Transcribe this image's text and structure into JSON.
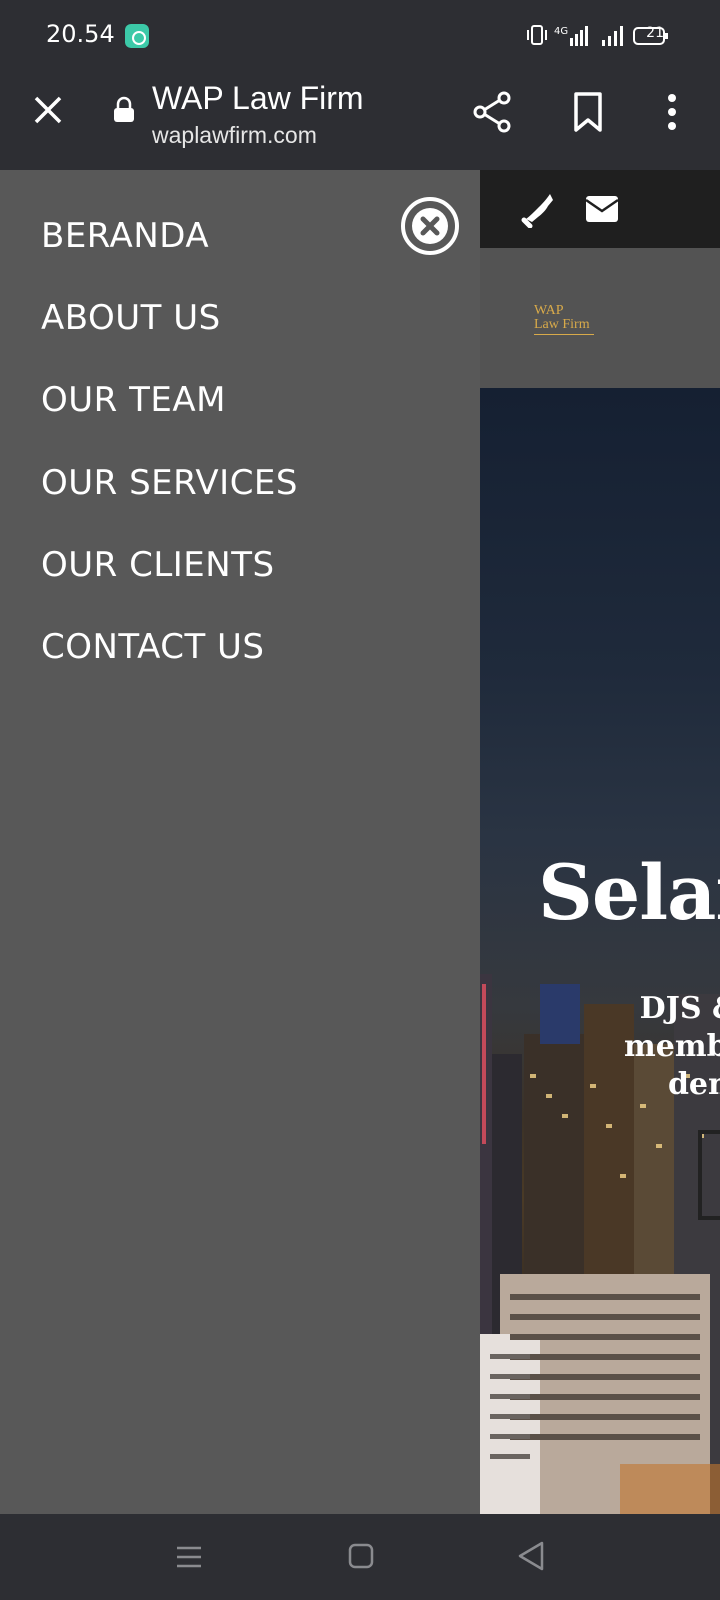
{
  "status_bar": {
    "time": "20.54",
    "battery": "21",
    "icons": [
      "app-notification-icon",
      "vibrate-icon",
      "4g-signal-icon",
      "signal-icon",
      "battery-icon"
    ]
  },
  "browser": {
    "title": "WAP Law Firm",
    "url": "waplawfirm.com",
    "icons": [
      "close-icon",
      "lock-icon",
      "share-icon",
      "bookmark-icon",
      "more-vert-icon"
    ]
  },
  "drawer": {
    "menu": [
      {
        "label": "BERANDA"
      },
      {
        "label": "ABOUT US"
      },
      {
        "label": "OUR TEAM"
      },
      {
        "label": "OUR SERVICES"
      },
      {
        "label": "OUR CLIENTS"
      },
      {
        "label": "CONTACT US"
      }
    ],
    "close_icon": "close-circle-icon"
  },
  "site": {
    "logo_line1": "WAP",
    "logo_line2": "Law Firm",
    "contact_icons": [
      "phone-icon",
      "mail-icon"
    ],
    "hero_title": "Selan",
    "hero_sub_1": "DJS & Part",
    "hero_sub_2": "membantu p",
    "hero_sub_3": "dengan"
  },
  "colors": {
    "drawer_bg": "#585858",
    "chrome_bg": "#2d2e33",
    "logo_gold": "#d8aa4a"
  }
}
